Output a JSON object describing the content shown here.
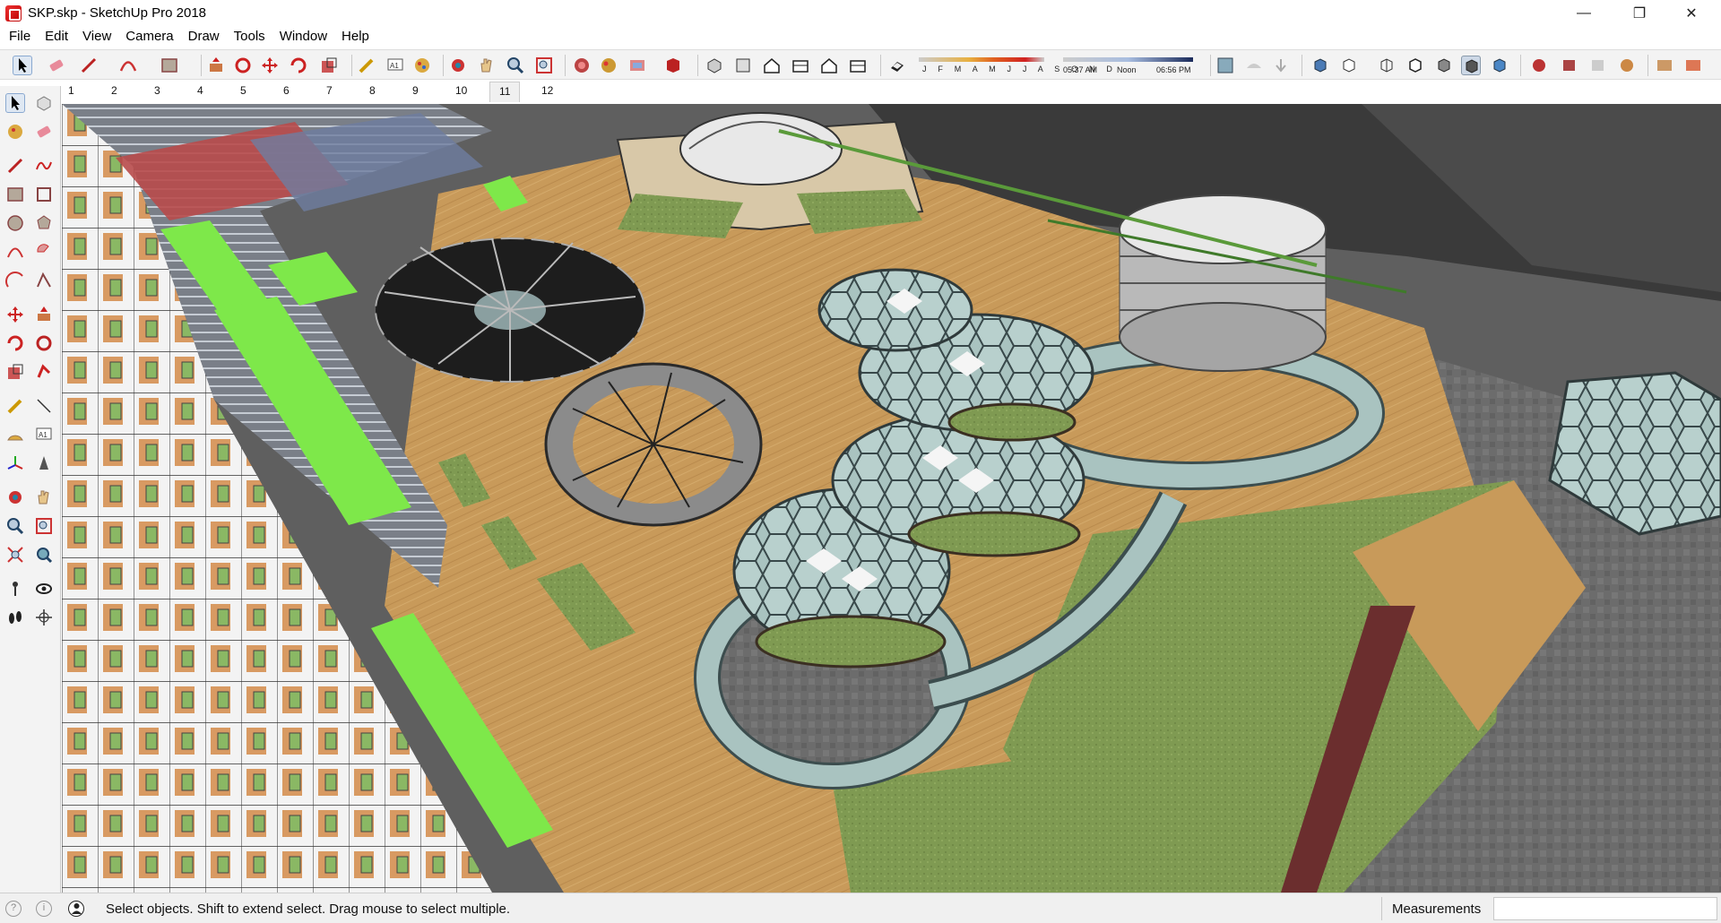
{
  "window": {
    "title": "SKP.skp - SketchUp Pro 2018",
    "minimize_glyph": "—",
    "restore_glyph": "❐",
    "close_glyph": "✕"
  },
  "menu": [
    {
      "label": "File"
    },
    {
      "label": "Edit"
    },
    {
      "label": "View"
    },
    {
      "label": "Camera"
    },
    {
      "label": "Draw"
    },
    {
      "label": "Tools"
    },
    {
      "label": "Window"
    },
    {
      "label": "Help"
    }
  ],
  "toolbar": {
    "icons": [
      "select-tool",
      "eraser-tool",
      "line-tool",
      "arc-tool",
      "rectangle-tool",
      "push-pull-tool",
      "follow-me-tool",
      "move-tool",
      "rotate-tool",
      "scale-tool",
      "tape-measure-tool",
      "text-tool",
      "paint-bucket-tool",
      "orbit-tool",
      "pan-tool",
      "zoom-tool",
      "zoom-extents-tool",
      "components-icon",
      "materials-icon",
      "styles-icon",
      "warehouse-icon",
      "iso-view",
      "top-view",
      "front-view",
      "right-view",
      "back-view",
      "left-view",
      "shadows-toggle",
      "xray-style",
      "wireframe-style",
      "hidden-line-style",
      "shaded-style",
      "textured-style",
      "monochrome-style",
      "section-plane",
      "extension-icon"
    ],
    "shadow": {
      "months": "J F M A M J J A S O N D",
      "time_start": "05:37 AM",
      "time_mid": "Noon",
      "time_end": "06:56 PM"
    }
  },
  "scenes": {
    "tabs": [
      "1",
      "2",
      "3",
      "4",
      "5",
      "6",
      "7",
      "8",
      "9",
      "10",
      "11",
      "12"
    ],
    "active": "11"
  },
  "left_tools": [
    "select",
    "make-component",
    "paint-bucket",
    "eraser",
    "line",
    "freehand",
    "rectangle",
    "rotated-rectangle",
    "circle",
    "polygon",
    "arc",
    "pie",
    "two-point-arc",
    "three-point-arc",
    "move",
    "push-pull",
    "rotate",
    "follow-me",
    "scale",
    "offset",
    "tape-measure",
    "dimension",
    "protractor",
    "text",
    "axes",
    "3d-text",
    "orbit",
    "pan",
    "zoom",
    "zoom-window",
    "zoom-extents",
    "previous-view",
    "position-camera",
    "look-around",
    "walk",
    "section-plane"
  ],
  "status": {
    "hint": "Select objects. Shift to extend select. Drag mouse to select multiple.",
    "measurements_label": "Measurements",
    "measurements_value": ""
  },
  "colors": {
    "accent_green": "#7ee84a",
    "deck_wood": "#c89a5a",
    "lawn": "#7f9a52",
    "glass": "#a9c3c0"
  }
}
